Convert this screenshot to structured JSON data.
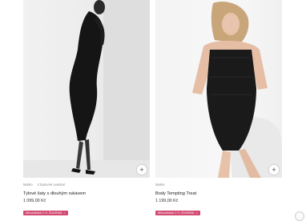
{
  "products": [
    {
      "brand": "Marko",
      "badge": "2 barevné ovedení",
      "title": "Tylové šaty s dlouhým rukávem",
      "price": "1 099,00 Kč",
      "promo": "Mikulášská 1+1 ZDARMA",
      "promo_icon": "tag-icon",
      "add_icon": "plus-icon"
    },
    {
      "brand": "Marko",
      "badge": "",
      "title": "Body Tempting Treat",
      "price": "1 199,00 Kč",
      "promo": "Mikulášská 1+1 ZDARMA",
      "promo_icon": "tag-icon",
      "add_icon": "plus-icon"
    }
  ],
  "colors": {
    "promo_bg": "#d24a72",
    "text": "#222222",
    "muted": "#8a8a8a"
  }
}
